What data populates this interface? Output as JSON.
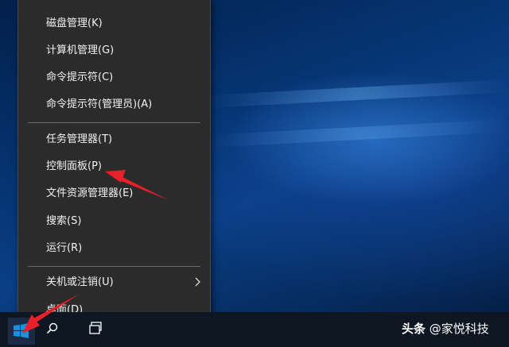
{
  "menu": {
    "items": [
      {
        "label": "磁盘管理(K)"
      },
      {
        "label": "计算机管理(G)"
      },
      {
        "label": "命令提示符(C)"
      },
      {
        "label": "命令提示符(管理员)(A)"
      },
      {
        "label": "任务管理器(T)"
      },
      {
        "label": "控制面板(P)"
      },
      {
        "label": "文件资源管理器(E)"
      },
      {
        "label": "搜索(S)"
      },
      {
        "label": "运行(R)"
      },
      {
        "label": "关机或注销(U)"
      },
      {
        "label": "桌面(D)"
      }
    ]
  },
  "watermark": {
    "brand": "头条",
    "handle": "@家悦科技"
  },
  "colors": {
    "menu_bg": "#2b2b2b",
    "menu_text": "#f2f2f2",
    "arrow_red": "#e8202a",
    "start_blue": "#1d8fe0"
  },
  "icons": {
    "start": "windows-logo-icon",
    "search": "search-icon",
    "task_view": "task-view-icon",
    "submenu": "chevron-right-icon"
  }
}
